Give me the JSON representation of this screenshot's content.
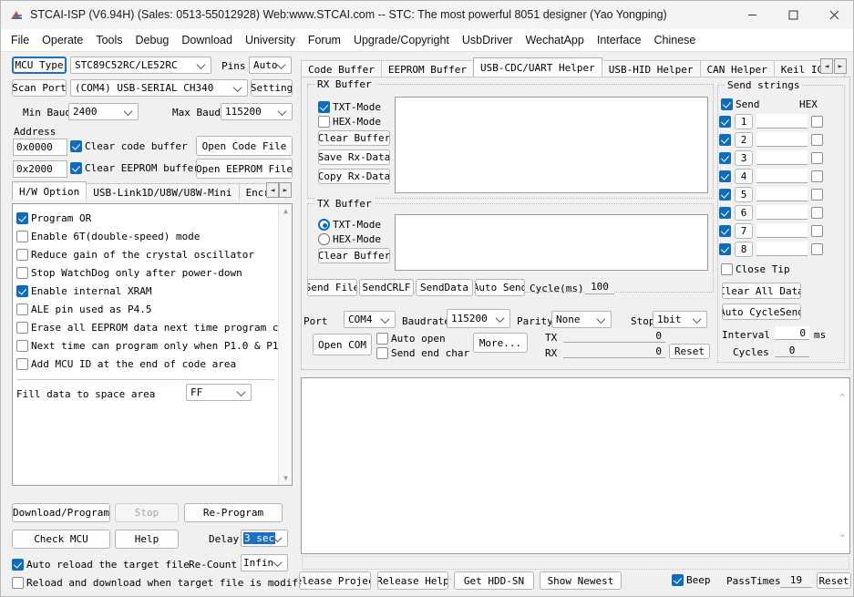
{
  "window": {
    "title": "STCAI-ISP (V6.94H) (Sales: 0513-55012928) Web:www.STCAI.com  -- STC: The most powerful 8051 designer (Yao Yongping)",
    "minimize": "—",
    "maximize": "☐",
    "close": "✕"
  },
  "menu": {
    "items": [
      "File",
      "Operate",
      "Tools",
      "Debug",
      "Download",
      "University",
      "Forum",
      "Upgrade/Copyright",
      "UsbDriver",
      "WechatApp",
      "Interface",
      "Chinese"
    ]
  },
  "left": {
    "mcu_type_button": "MCU Type",
    "mcu_type_value": "STC89C52RC/LE52RC",
    "pins_label": "Pins",
    "pins_value": "Auto",
    "scan_port_button": "Scan Port",
    "port_value": "(COM4) USB-SERIAL CH340",
    "setting_button": "Setting",
    "min_baud_label": "Min Baud",
    "min_baud_value": "2400",
    "max_baud_label": "Max Baud",
    "max_baud_value": "115200",
    "address_label": "Address",
    "code_addr_value": "0x0000",
    "clear_code_buffer": "Clear code buffer",
    "open_code_file": "Open Code File",
    "eeprom_addr_value": "0x2000",
    "clear_eeprom_buffer": "Clear EEPROM buffer",
    "open_eeprom_file": "Open EEPROM File",
    "tabs": [
      {
        "label": "H/W Option",
        "active": true
      },
      {
        "label": "USB-Link1D/U8W/U8W-Mini",
        "active": false
      },
      {
        "label": "Encrypti",
        "active": false
      }
    ],
    "tab_scroll_left": "◄",
    "tab_scroll_right": "►",
    "options": [
      {
        "label": "Program OR",
        "checked": true
      },
      {
        "label": "Enable 6T(double-speed) mode",
        "checked": false
      },
      {
        "label": "Reduce gain of the crystal oscillator",
        "checked": false
      },
      {
        "label": "Stop WatchDog only after power-down",
        "checked": false
      },
      {
        "label": "Enable internal XRAM",
        "checked": true
      },
      {
        "label": "ALE pin used as P4.5",
        "checked": false
      },
      {
        "label": "Erase all EEPROM data next time program c",
        "checked": false
      },
      {
        "label": "Next time can program only when P1.0 & P1",
        "checked": false
      },
      {
        "label": "Add MCU ID at the end of code area",
        "checked": false
      }
    ],
    "fill_data_label": "Fill data to space area",
    "fill_data_value": "FF",
    "download_button": "Download/Program",
    "stop_button": "Stop",
    "reprogram_button": "Re-Program",
    "check_mcu_button": "Check MCU",
    "help_button": "Help",
    "delay_label": "Delay",
    "delay_value": "3 sec",
    "recount_label": "Re-Count",
    "recount_value": "Infin",
    "auto_reload_label": "Auto reload the target file",
    "auto_reload_checked": true,
    "reload_modified_label": "Reload and download when target file is modified",
    "reload_modified_checked": false
  },
  "right": {
    "tabs": [
      {
        "label": "Code Buffer",
        "active": false
      },
      {
        "label": "EEPROM Buffer",
        "active": false
      },
      {
        "label": "USB-CDC/UART Helper",
        "active": true
      },
      {
        "label": "USB-HID Helper",
        "active": false
      },
      {
        "label": "CAN Helper",
        "active": false
      },
      {
        "label": "Keil ICE Settings",
        "active": false
      }
    ],
    "tab_scroll_left": "◄",
    "tab_scroll_right": "►",
    "rx": {
      "group_label": "RX Buffer",
      "txt_mode_label": "TXT-Mode",
      "txt_mode_checked": true,
      "hex_mode_label": "HEX-Mode",
      "hex_mode_checked": false,
      "clear_buffer": "Clear Buffer",
      "save_rx_data": "Save Rx-Data",
      "copy_rx_data": "Copy Rx-Data",
      "text": ""
    },
    "tx": {
      "group_label": "TX Buffer",
      "txt_mode_label": "TXT-Mode",
      "txt_mode_selected": true,
      "hex_mode_label": "HEX-Mode",
      "hex_mode_selected": false,
      "clear_buffer": "Clear Buffer",
      "text": "",
      "send_file": "Send File",
      "send_crlf": "SendCRLF",
      "send_data": "SendData",
      "auto_send": "Auto Send",
      "cycle_label": "Cycle(ms)",
      "cycle_value": "100"
    },
    "serial": {
      "port_label": "Port",
      "port_value": "COM4",
      "baudrate_label": "Baudrate",
      "baudrate_value": "115200",
      "parity_label": "Parity",
      "parity_value": "None",
      "stop_label": "Stop",
      "stop_value": "1bit",
      "open_com": "Open COM",
      "auto_open_label": "Auto open",
      "auto_open_checked": false,
      "send_end_char_label": "Send end char",
      "send_end_char_checked": false,
      "more_button": "More...",
      "tx_label": "TX",
      "tx_value": "0",
      "rx_label": "RX",
      "rx_value": "0",
      "reset_button": "Reset"
    },
    "send_strings": {
      "group_label": "Send strings",
      "send_all_checked": true,
      "send_header": "Send",
      "hex_header": "HEX",
      "rows": [
        {
          "num": "1",
          "checked": true,
          "value": "",
          "hex": false
        },
        {
          "num": "2",
          "checked": true,
          "value": "",
          "hex": false
        },
        {
          "num": "3",
          "checked": true,
          "value": "",
          "hex": false
        },
        {
          "num": "4",
          "checked": true,
          "value": "",
          "hex": false
        },
        {
          "num": "5",
          "checked": true,
          "value": "",
          "hex": false
        },
        {
          "num": "6",
          "checked": true,
          "value": "",
          "hex": false
        },
        {
          "num": "7",
          "checked": true,
          "value": "",
          "hex": false
        },
        {
          "num": "8",
          "checked": true,
          "value": "",
          "hex": false
        }
      ],
      "close_tip_label": "Close Tip",
      "close_tip_checked": false,
      "clear_all_data": "Clear All Data",
      "auto_cycle_send": "Auto CycleSend",
      "interval_label": "Interval",
      "interval_value": "0",
      "interval_unit": "ms",
      "cycles_label": "Cycles",
      "cycles_value": "0"
    },
    "log": {
      "text": ""
    },
    "statusbar": {
      "text": ""
    },
    "bottom": {
      "release_project": "Release Project",
      "release_help": "Release Help",
      "get_hdd_sn": "Get HDD-SN",
      "show_newest": "Show Newest",
      "beep_label": "Beep",
      "beep_checked": true,
      "passtimes_label": "PassTimes",
      "passtimes_value": "19",
      "reset_button": "Reset"
    }
  }
}
